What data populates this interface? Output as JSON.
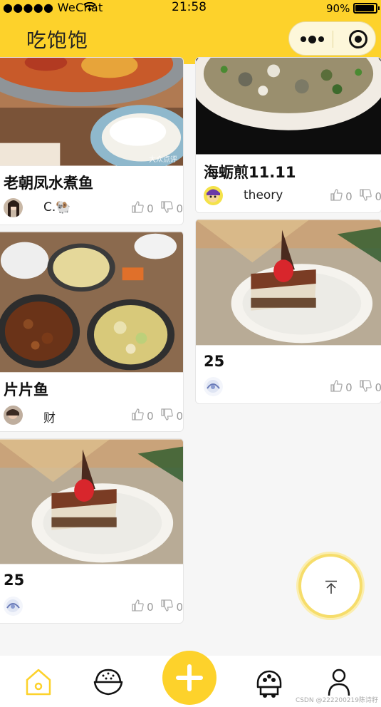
{
  "status_bar": {
    "carrier": "●●●●● WeChat",
    "time": "21:58",
    "battery": "90%"
  },
  "header": {
    "title": "吃饱饱"
  },
  "feed": {
    "left": [
      {
        "title": "老朝凤水煮鱼",
        "author": "C.🐏",
        "likes": "0",
        "dislikes": "0",
        "photo_watermark": "大众点评"
      },
      {
        "title": "片片鱼",
        "author": "财",
        "likes": "0",
        "dislikes": "0"
      },
      {
        "title": "25",
        "author": "",
        "likes": "0",
        "dislikes": "0"
      }
    ],
    "right": [
      {
        "title": "海蛎煎11.11",
        "author": "theory",
        "likes": "0",
        "dislikes": "0"
      },
      {
        "title": "25",
        "author": "",
        "likes": "0",
        "dislikes": "0"
      }
    ]
  },
  "back_to_top": {
    "icon": "arrow-up-to-top-icon"
  },
  "tabbar": {
    "items": [
      {
        "icon": "home-icon",
        "active": true
      },
      {
        "icon": "rice-bowl-icon",
        "active": false
      },
      {
        "icon": "plus-icon",
        "active": false
      },
      {
        "icon": "food-truck-icon",
        "active": false
      },
      {
        "icon": "user-icon",
        "active": false
      }
    ]
  },
  "watermark": "CSDN @222200219陈诗籽",
  "colors": {
    "brand": "#fdd22b",
    "background": "#f6f6f6"
  }
}
